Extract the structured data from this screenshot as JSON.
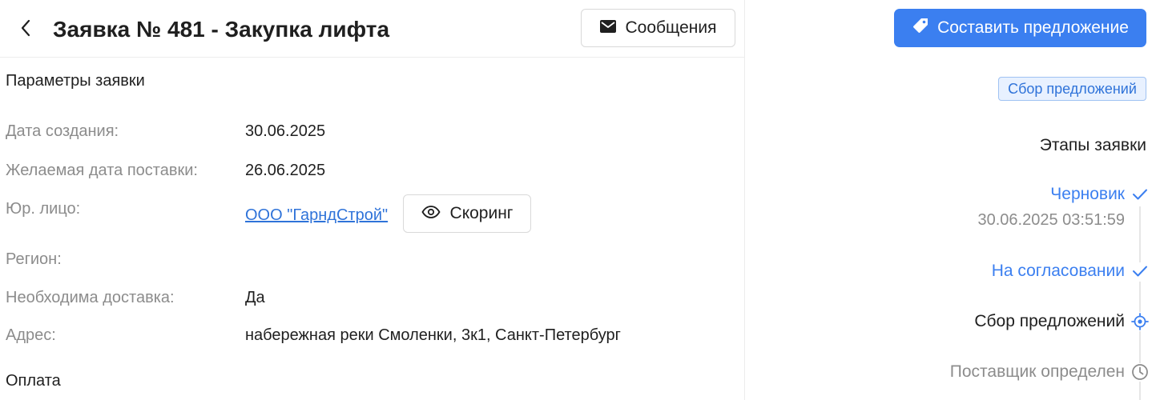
{
  "header": {
    "title": "Заявка № 481 - Закупка лифта",
    "messages_label": "Сообщения"
  },
  "params": {
    "section_title": "Параметры заявки",
    "created_label": "Дата создания:",
    "created_value": "30.06.2025",
    "delivery_date_label": "Желаемая дата поставки:",
    "delivery_date_value": "26.06.2025",
    "legal_entity_label": "Юр. лицо:",
    "legal_entity_value": "ООО \"ГарндСтрой\"",
    "scoring_label": "Скоринг",
    "region_label": "Регион:",
    "region_value": "",
    "delivery_needed_label": "Необходима доставка:",
    "delivery_needed_value": "Да",
    "address_label": "Адрес:",
    "address_value": "набережная реки Смоленки, 3к1, Санкт-Петербург"
  },
  "payment": {
    "section_title": "Оплата"
  },
  "sidebar": {
    "primary_action_label": "Составить предложение",
    "status_badge": "Сбор предложений",
    "stages_title": "Этапы заявки",
    "stages": [
      {
        "label": "Черновик",
        "state": "done",
        "icon": "check-icon",
        "time": "30.06.2025 03:51:59"
      },
      {
        "label": "На согласовании",
        "state": "done",
        "icon": "check-icon"
      },
      {
        "label": "Сбор предложений",
        "state": "active",
        "icon": "target-icon"
      },
      {
        "label": "Поставщик определен",
        "state": "pending",
        "icon": "clock-icon"
      }
    ]
  },
  "colors": {
    "accent": "#3b7ff0",
    "link": "#2f73d9",
    "muted_text": "#8c8c8c",
    "badge_bg": "#e8f1ff"
  }
}
